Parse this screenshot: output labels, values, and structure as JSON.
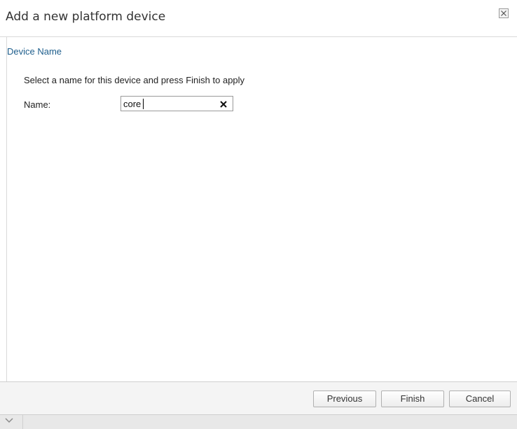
{
  "dialog": {
    "title": "Add a new platform device",
    "close_icon": "close-icon"
  },
  "section": {
    "title": "Device Name",
    "instructions": "Select a name for this device and press Finish to apply"
  },
  "form": {
    "name_label": "Name:",
    "name_value": "core",
    "clear_icon": "clear-x-icon"
  },
  "footer": {
    "previous_label": "Previous",
    "finish_label": "Finish",
    "cancel_label": "Cancel"
  },
  "bottom_strip": {
    "icon": "chevron-down-icon"
  },
  "colors": {
    "section_title": "#1e5e8c",
    "footer_background": "#f4f4f4"
  }
}
